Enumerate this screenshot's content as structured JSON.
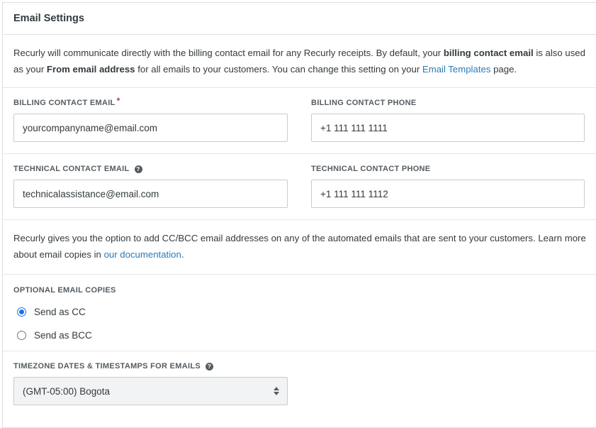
{
  "header": {
    "title": "Email Settings"
  },
  "intro": {
    "part1": "Recurly will communicate directly with the billing contact email for any Recurly receipts. By default, your ",
    "bold1": "billing contact email",
    "part2": " is also used as your ",
    "bold2": "From email address",
    "part3": " for all emails to your customers. You can change this setting on your ",
    "link": "Email Templates",
    "part4": " page."
  },
  "billing": {
    "email_label": "BILLING CONTACT EMAIL",
    "required_mark": "*",
    "email_value": "yourcompanyname@email.com",
    "phone_label": "BILLING CONTACT PHONE",
    "phone_value": "+1 111 111 1111"
  },
  "technical": {
    "email_label": "TECHNICAL CONTACT EMAIL",
    "help_glyph": "?",
    "email_value": "technicalassistance@email.com",
    "phone_label": "TECHNICAL CONTACT PHONE",
    "phone_value": "+1 111 111 1112"
  },
  "copies": {
    "part1": "Recurly gives you the option to add CC/BCC email addresses on any of the automated emails that are sent to your customers. Learn more about email copies in ",
    "link": "our documentation",
    "part2": "."
  },
  "optional": {
    "label": "OPTIONAL EMAIL COPIES",
    "options": [
      {
        "label": "Send as CC",
        "checked": true
      },
      {
        "label": "Send as BCC",
        "checked": false
      }
    ]
  },
  "timezone": {
    "label": "TIMEZONE DATES & TIMESTAMPS FOR EMAILS",
    "help_glyph": "?",
    "selected": "(GMT-05:00) Bogota"
  },
  "colors": {
    "link": "#2a7ab6",
    "required": "#d9282f",
    "radio_checked": "#1a73e8"
  }
}
